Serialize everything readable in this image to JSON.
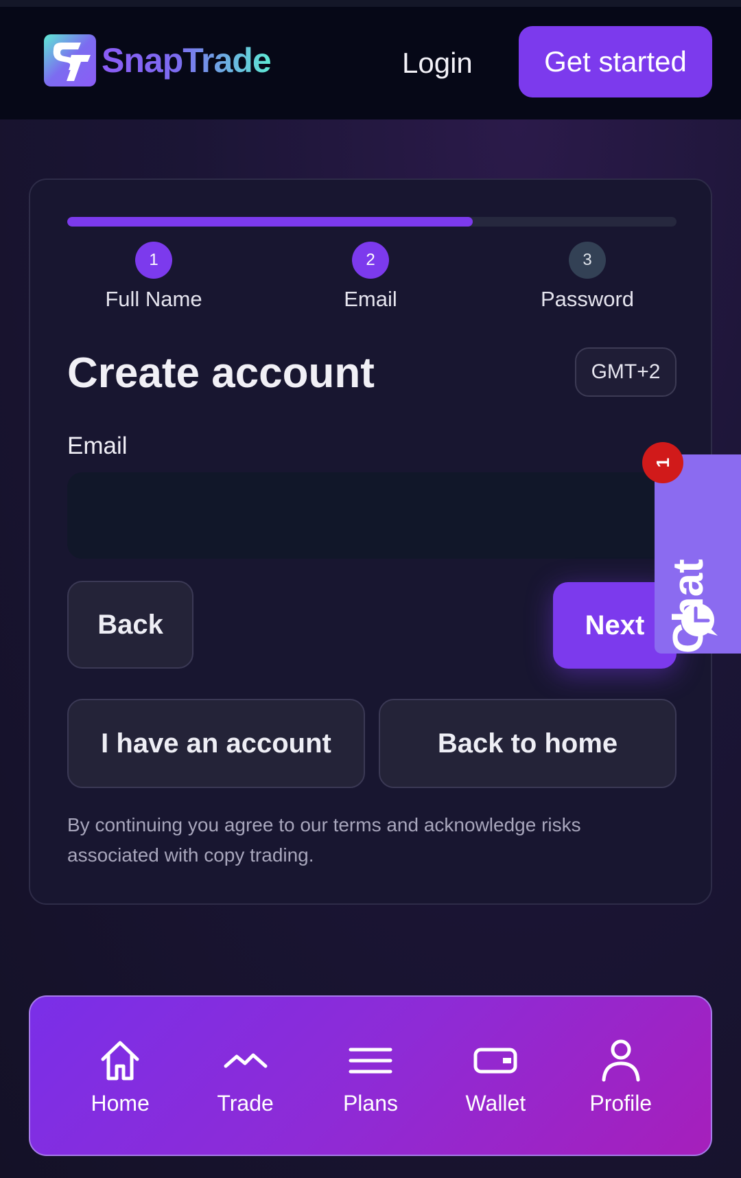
{
  "header": {
    "brand": "SnapTrade",
    "login_label": "Login",
    "get_started_label": "Get started"
  },
  "progress": {
    "fraction": 0.665
  },
  "steps": [
    {
      "number": "1",
      "label": "Full Name",
      "active": true
    },
    {
      "number": "2",
      "label": "Email",
      "active": true
    },
    {
      "number": "3",
      "label": "Password",
      "active": false
    }
  ],
  "form": {
    "title": "Create account",
    "timezone": "GMT+2",
    "email_label": "Email",
    "email_value": "",
    "email_placeholder": "",
    "back_label": "Back",
    "next_label": "Next",
    "have_account_label": "I have an account",
    "back_home_label": "Back to home",
    "terms": "By continuing you agree to our terms and acknowledge risks associated with copy trading."
  },
  "chat": {
    "label": "Chat",
    "badge": "1"
  },
  "nav": [
    {
      "label": "Home",
      "icon": "home-icon"
    },
    {
      "label": "Trade",
      "icon": "trend-icon"
    },
    {
      "label": "Plans",
      "icon": "menu-icon"
    },
    {
      "label": "Wallet",
      "icon": "wallet-icon"
    },
    {
      "label": "Profile",
      "icon": "user-icon"
    }
  ],
  "colors": {
    "accent": "#7c3aed",
    "nav_gradient_start": "#7a2fe8",
    "nav_gradient_end": "#a61fbb",
    "badge": "#d11a1a"
  }
}
